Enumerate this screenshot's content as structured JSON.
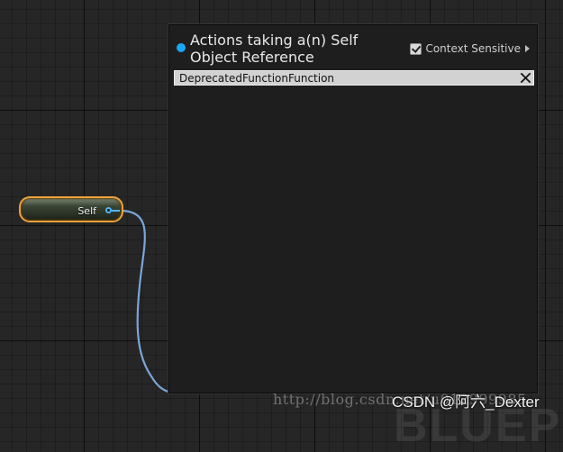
{
  "canvas": {
    "background_word": "BLUEPRINT"
  },
  "self_node": {
    "label": "Self"
  },
  "action_menu": {
    "title": "Actions taking a(n) Self Object Reference",
    "context_sensitive_label": "Context Sensitive",
    "context_sensitive_checked": true,
    "search_value": "DeprecatedFunctionFunction",
    "status_dot_color": "#19a7f3"
  },
  "colors": {
    "wire": "#7aa6d8",
    "pin": "#4fb6ff",
    "node_outline": "#e8a23a"
  },
  "icons": {
    "status": "blue-dot-icon",
    "checkbox": "checkbox-checked-icon",
    "chevron": "chevron-right-icon",
    "clear": "close-icon"
  },
  "watermark": {
    "url": "http://blog.csdn.net/u012999985",
    "label": "CSDN @阿六_Dexter"
  }
}
